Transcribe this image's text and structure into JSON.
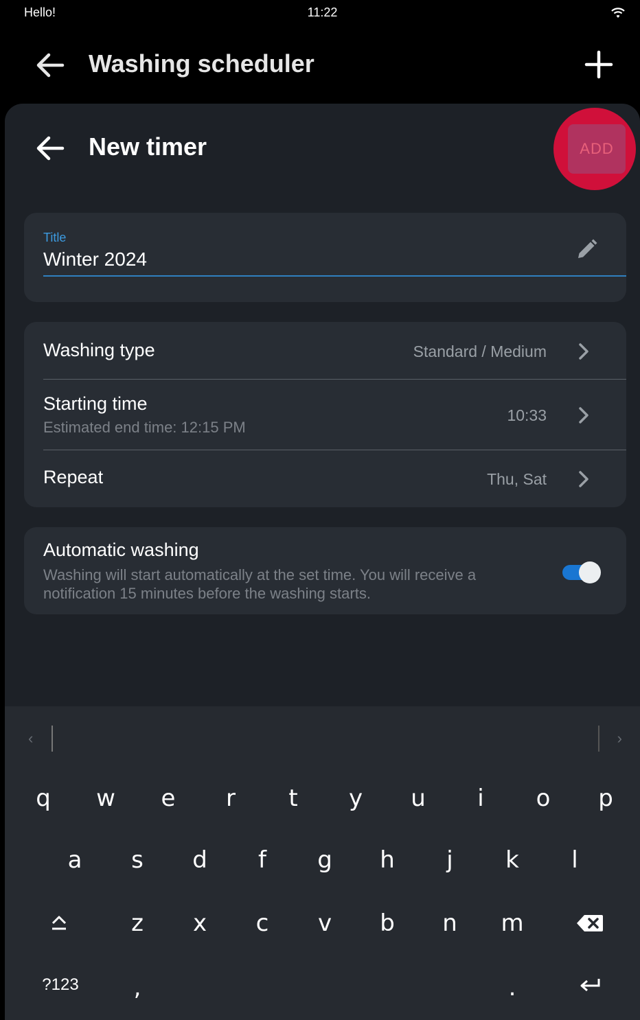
{
  "status": {
    "greeting": "Hello!",
    "time": "11:22"
  },
  "appbar": {
    "title": "Washing scheduler"
  },
  "sheet": {
    "title": "New timer",
    "add_label": "ADD",
    "title_field": {
      "label": "Title",
      "value": "Winter 2024"
    },
    "washing_type": {
      "label": "Washing type",
      "value": "Standard / Medium"
    },
    "starting_time": {
      "label": "Starting time",
      "sub": "Estimated end time: 12:15 PM",
      "value": "10:33"
    },
    "repeat": {
      "label": "Repeat",
      "value": "Thu, Sat"
    },
    "automatic": {
      "label": "Automatic washing",
      "description": "Washing will start automatically at the set time. You will receive a notification 15 minutes before the washing starts.",
      "enabled": true
    }
  },
  "keyboard": {
    "row1": [
      "q",
      "w",
      "e",
      "r",
      "t",
      "y",
      "u",
      "i",
      "o",
      "p"
    ],
    "row2": [
      "a",
      "s",
      "d",
      "f",
      "g",
      "h",
      "j",
      "k",
      "l"
    ],
    "row3": [
      "z",
      "x",
      "c",
      "v",
      "b",
      "n",
      "m"
    ],
    "symbols_label": "?123",
    "comma": ",",
    "period": "."
  },
  "colors": {
    "accent": "#3d9be0",
    "highlight": "#d0103a",
    "toggle_on": "#1976d2"
  }
}
